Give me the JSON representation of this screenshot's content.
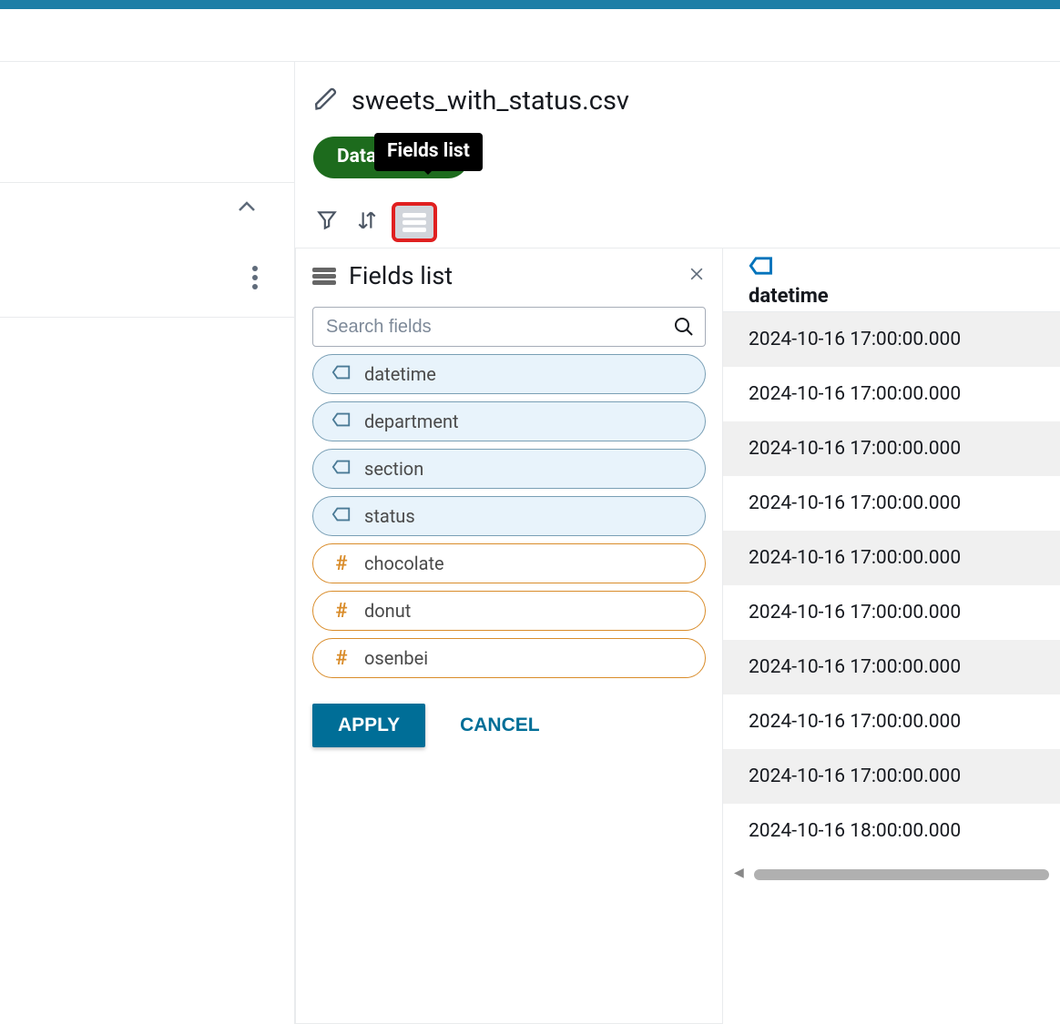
{
  "file_title": "sweets_with_status.csv",
  "pill_text_full": "Data S        eated",
  "tooltip_text": "Fields list",
  "panel_title": "Fields list",
  "search_placeholder": "Search fields",
  "fields": [
    {
      "name": "datetime",
      "kind": "tag"
    },
    {
      "name": "department",
      "kind": "tag"
    },
    {
      "name": "section",
      "kind": "tag"
    },
    {
      "name": "status",
      "kind": "tag"
    },
    {
      "name": "chocolate",
      "kind": "hash"
    },
    {
      "name": "donut",
      "kind": "hash"
    },
    {
      "name": "osenbei",
      "kind": "hash"
    }
  ],
  "apply_label": "APPLY",
  "cancel_label": "CANCEL",
  "column_header": "datetime",
  "rows": [
    "2024-10-16 17:00:00.000",
    "2024-10-16 17:00:00.000",
    "2024-10-16 17:00:00.000",
    "2024-10-16 17:00:00.000",
    "2024-10-16 17:00:00.000",
    "2024-10-16 17:00:00.000",
    "2024-10-16 17:00:00.000",
    "2024-10-16 17:00:00.000",
    "2024-10-16 17:00:00.000",
    "2024-10-16 18:00:00.000"
  ]
}
